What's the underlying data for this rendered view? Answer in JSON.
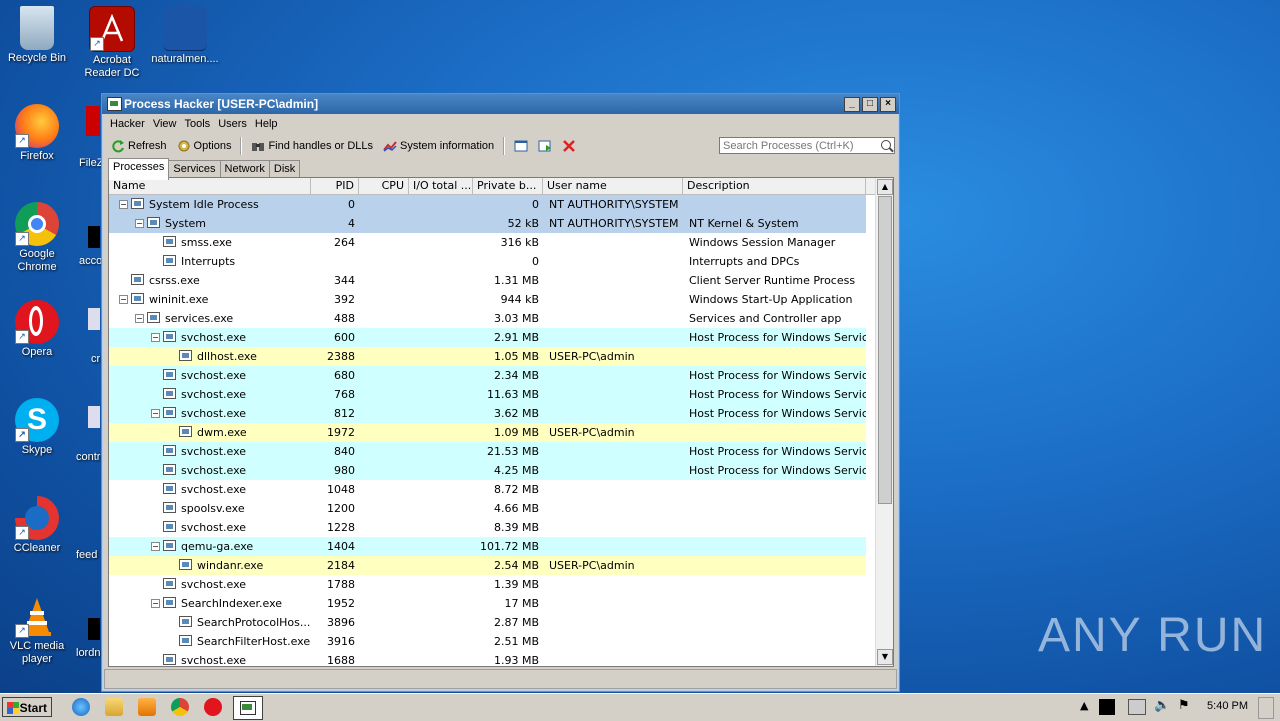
{
  "desktop": {
    "icons": [
      {
        "label": "Recycle Bin",
        "name": "recycle-bin-icon"
      },
      {
        "label": "Acrobat Reader DC",
        "name": "acrobat-icon"
      },
      {
        "label": "naturalmen....",
        "name": "file-icon"
      },
      {
        "label": "Firefox",
        "name": "firefox-icon"
      },
      {
        "label": "Google Chrome",
        "name": "chrome-icon"
      },
      {
        "label": "Opera",
        "name": "opera-icon"
      },
      {
        "label": "Skype",
        "name": "skype-icon"
      },
      {
        "label": "CCleaner",
        "name": "ccleaner-icon"
      },
      {
        "label": "VLC media player",
        "name": "vlc-icon"
      }
    ],
    "partial_labels": [
      "FileZ",
      "acco",
      "cr",
      "contr",
      "feed",
      "lordn"
    ],
    "watermark": "ANY RUN"
  },
  "window": {
    "title": "Process Hacker [USER-PC\\admin]",
    "menu": [
      "Hacker",
      "View",
      "Tools",
      "Users",
      "Help"
    ],
    "toolbar": {
      "refresh": "Refresh",
      "options": "Options",
      "find": "Find handles or DLLs",
      "sysinfo": "System information"
    },
    "search_placeholder": "Search Processes (Ctrl+K)",
    "tabs": [
      "Processes",
      "Services",
      "Network",
      "Disk"
    ],
    "columns": [
      "Name",
      "PID",
      "CPU",
      "I/O total ...",
      "Private b...",
      "User name",
      "Description"
    ],
    "processes": [
      {
        "name": "System Idle Process",
        "pid": "0",
        "priv": "0",
        "user": "NT AUTHORITY\\SYSTEM",
        "desc": ""
      },
      {
        "name": "System",
        "pid": "4",
        "priv": "52 kB",
        "user": "NT AUTHORITY\\SYSTEM",
        "desc": "NT Kernel & System"
      },
      {
        "name": "smss.exe",
        "pid": "264",
        "priv": "316 kB",
        "user": "",
        "desc": "Windows Session Manager"
      },
      {
        "name": "Interrupts",
        "pid": "",
        "priv": "0",
        "user": "",
        "desc": "Interrupts and DPCs"
      },
      {
        "name": "csrss.exe",
        "pid": "344",
        "priv": "1.31 MB",
        "user": "",
        "desc": "Client Server Runtime Process"
      },
      {
        "name": "wininit.exe",
        "pid": "392",
        "priv": "944 kB",
        "user": "",
        "desc": "Windows Start-Up Application"
      },
      {
        "name": "services.exe",
        "pid": "488",
        "priv": "3.03 MB",
        "user": "",
        "desc": "Services and Controller app"
      },
      {
        "name": "svchost.exe",
        "pid": "600",
        "priv": "2.91 MB",
        "user": "",
        "desc": "Host Process for Windows Services"
      },
      {
        "name": "dllhost.exe",
        "pid": "2388",
        "priv": "1.05 MB",
        "user": "USER-PC\\admin",
        "desc": ""
      },
      {
        "name": "svchost.exe",
        "pid": "680",
        "priv": "2.34 MB",
        "user": "",
        "desc": "Host Process for Windows Services"
      },
      {
        "name": "svchost.exe",
        "pid": "768",
        "priv": "11.63 MB",
        "user": "",
        "desc": "Host Process for Windows Services"
      },
      {
        "name": "svchost.exe",
        "pid": "812",
        "priv": "3.62 MB",
        "user": "",
        "desc": "Host Process for Windows Services"
      },
      {
        "name": "dwm.exe",
        "pid": "1972",
        "priv": "1.09 MB",
        "user": "USER-PC\\admin",
        "desc": ""
      },
      {
        "name": "svchost.exe",
        "pid": "840",
        "priv": "21.53 MB",
        "user": "",
        "desc": "Host Process for Windows Services"
      },
      {
        "name": "svchost.exe",
        "pid": "980",
        "priv": "4.25 MB",
        "user": "",
        "desc": "Host Process for Windows Services"
      },
      {
        "name": "svchost.exe",
        "pid": "1048",
        "priv": "8.72 MB",
        "user": "",
        "desc": ""
      },
      {
        "name": "spoolsv.exe",
        "pid": "1200",
        "priv": "4.66 MB",
        "user": "",
        "desc": ""
      },
      {
        "name": "svchost.exe",
        "pid": "1228",
        "priv": "8.39 MB",
        "user": "",
        "desc": ""
      },
      {
        "name": "qemu-ga.exe",
        "pid": "1404",
        "priv": "101.72 MB",
        "user": "",
        "desc": ""
      },
      {
        "name": "windanr.exe",
        "pid": "2184",
        "priv": "2.54 MB",
        "user": "USER-PC\\admin",
        "desc": ""
      },
      {
        "name": "svchost.exe",
        "pid": "1788",
        "priv": "1.39 MB",
        "user": "",
        "desc": ""
      },
      {
        "name": "SearchIndexer.exe",
        "pid": "1952",
        "priv": "17 MB",
        "user": "",
        "desc": ""
      },
      {
        "name": "SearchProtocolHos...",
        "pid": "3896",
        "priv": "2.87 MB",
        "user": "",
        "desc": ""
      },
      {
        "name": "SearchFilterHost.exe",
        "pid": "3916",
        "priv": "2.51 MB",
        "user": "",
        "desc": ""
      },
      {
        "name": "svchost.exe",
        "pid": "1688",
        "priv": "1.93 MB",
        "user": "",
        "desc": ""
      }
    ]
  },
  "taskbar": {
    "start": "Start",
    "clock": "5:40 PM"
  },
  "colors": {
    "system": "#b9d1ea",
    "service": "#d0ffff",
    "user": "#ffffc0"
  }
}
